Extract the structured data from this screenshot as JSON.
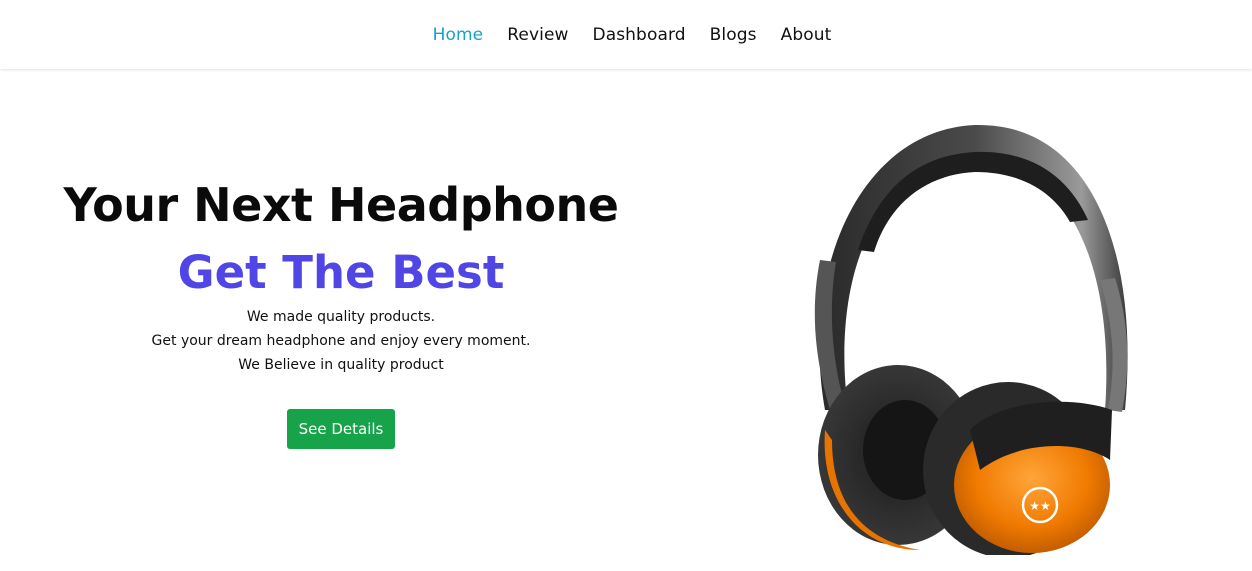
{
  "nav": {
    "items": [
      {
        "label": "Home",
        "active": true
      },
      {
        "label": "Review",
        "active": false
      },
      {
        "label": "Dashboard",
        "active": false
      },
      {
        "label": "Blogs",
        "active": false
      },
      {
        "label": "About",
        "active": false
      }
    ],
    "active_color": "#17a2c8"
  },
  "hero": {
    "title": "Your Next Headphone",
    "subtitle": "Get The Best",
    "subtitle_color": "#4f46e5",
    "lines": [
      "We made quality products.",
      "Get your dream headphone and enjoy every moment.",
      "We Believe in quality product"
    ],
    "cta_label": "See Details",
    "cta_color": "#16a34a"
  },
  "image": {
    "subject": "headphone-image",
    "accent_color": "#f57c00"
  }
}
